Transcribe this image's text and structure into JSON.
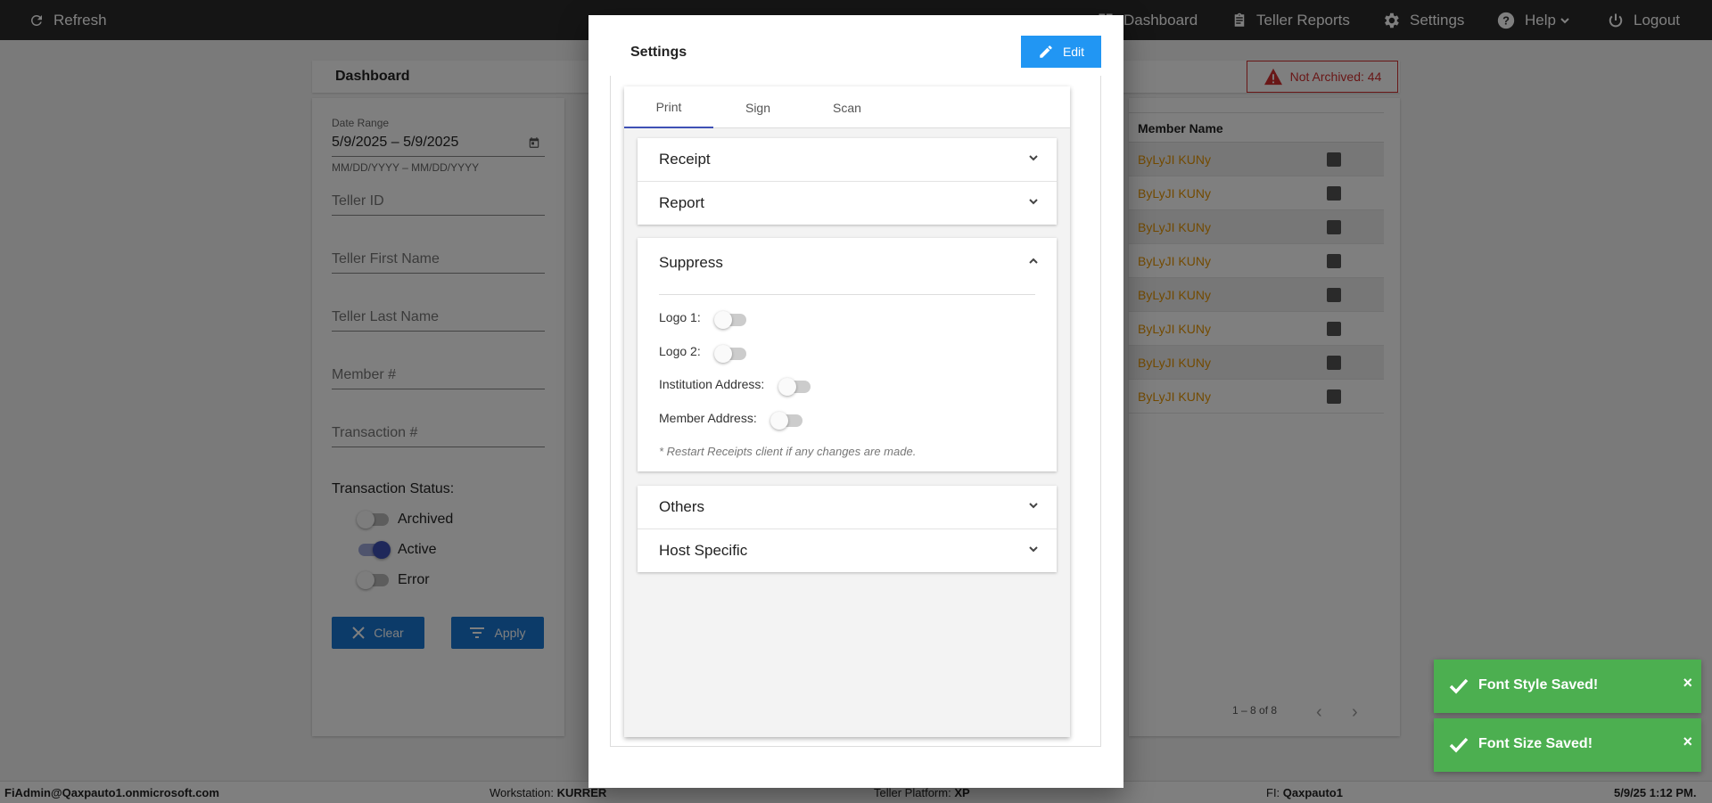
{
  "topbar": {
    "refresh": "Refresh",
    "nav": [
      "Dashboard",
      "Teller Reports",
      "Settings",
      "Help",
      "Logout"
    ]
  },
  "dashboard": {
    "title": "Dashboard",
    "not_archived": "Not Archived: 44",
    "filters": {
      "date_range_label": "Date Range",
      "date_range_value": "5/9/2025 – 5/9/2025",
      "date_hint": "MM/DD/YYYY – MM/DD/YYYY",
      "teller_id": "Teller ID",
      "teller_first_name": "Teller First Name",
      "teller_last_name": "Teller Last Name",
      "member_no": "Member #",
      "transaction_no": "Transaction #",
      "status_label": "Transaction Status:",
      "statuses": [
        {
          "label": "Archived",
          "on": false
        },
        {
          "label": "Active",
          "on": true
        },
        {
          "label": "Error",
          "on": false
        }
      ],
      "clear": "Clear",
      "apply": "Apply"
    },
    "results": {
      "column": "Member Name",
      "rows": [
        "ByLyJI KUNy",
        "ByLyJI KUNy",
        "ByLyJI KUNy",
        "ByLyJI KUNy",
        "ByLyJI KUNy",
        "ByLyJI KUNy",
        "ByLyJI KUNy",
        "ByLyJI KUNy"
      ],
      "pager": "1 – 8 of 8"
    }
  },
  "modal": {
    "title": "Settings",
    "edit": "Edit",
    "tabs": [
      "Print",
      "Sign",
      "Scan"
    ],
    "active_tab": "Print",
    "panels": {
      "receipt": "Receipt",
      "report": "Report",
      "suppress": "Suppress",
      "others": "Others",
      "host_specific": "Host Specific"
    },
    "suppress_items": [
      "Logo 1:",
      "Logo 2:",
      "Institution Address:",
      "Member Address:"
    ],
    "note": "* Restart Receipts client if any changes are made."
  },
  "toasts": [
    "Font Style Saved!",
    "Font Size Saved!"
  ],
  "statusbar": {
    "user": "FiAdmin@Qaxpauto1.onmicrosoft.com",
    "workstation_label": "Workstation:",
    "workstation": "KURRER",
    "platform_label": "Teller Platform:",
    "platform": "XP",
    "fi_label": "FI:",
    "fi": "Qaxpauto1",
    "datetime": "5/9/25 1:12 PM."
  },
  "colors": {
    "accent": "#1976d2",
    "toast": "#4caf50",
    "warning": "#d32f2f",
    "member_name": "#e69500"
  }
}
